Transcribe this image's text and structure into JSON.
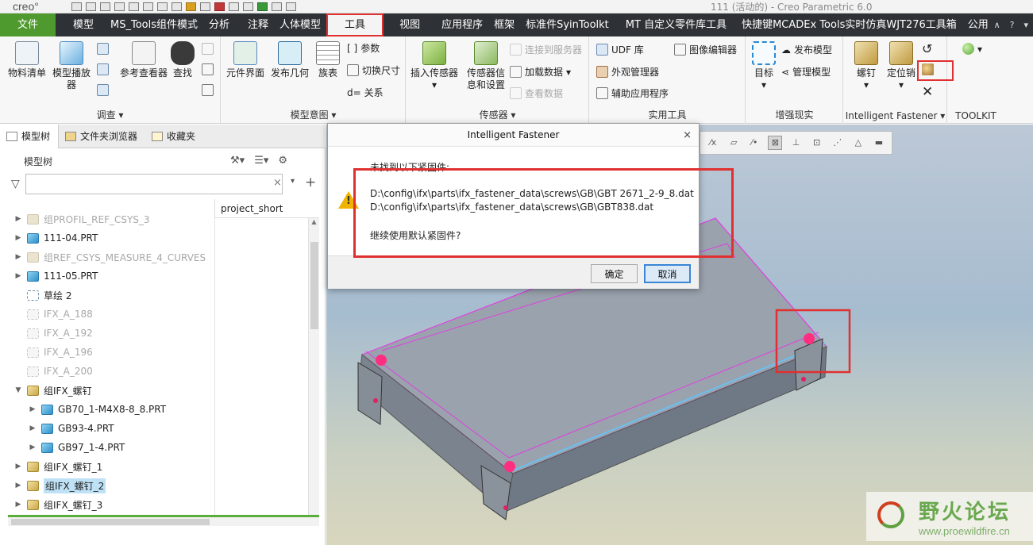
{
  "app": {
    "logo": "creo°",
    "window_title": "111 (活动的) - Creo Parametric 6.0"
  },
  "menu": {
    "tabs": [
      "文件",
      "模型",
      "MS_Tools组件模式",
      "分析",
      "注释",
      "人体模型",
      "工具",
      "视图",
      "应用程序",
      "框架",
      "标准件SyinToolkt",
      "MT 自定义零件库工具",
      "快捷键MCADEx Tools实时仿真WJT276工具箱",
      "公用"
    ],
    "active_tab": "工具"
  },
  "ribbon": {
    "groups": {
      "investigate": {
        "label": "调查",
        "buttons": [
          "物料清单",
          "模型播放器",
          "参考查看器",
          "查找"
        ]
      },
      "model_intent": {
        "label": "模型意图",
        "buttons": [
          "元件界面",
          "发布几何",
          "族表"
        ],
        "small": [
          "参数",
          "切换尺寸",
          "关系"
        ]
      },
      "sensor": {
        "label": "传感器",
        "buttons": [
          "插入传感器",
          "传感器信息和设置"
        ],
        "small": [
          "连接到服务器",
          "加载数据",
          "查看数据"
        ]
      },
      "utilities": {
        "label": "实用工具",
        "small": [
          "UDF 库",
          "外观管理器",
          "辅助应用程序",
          "图像编辑器"
        ]
      },
      "ar": {
        "label": "增强现实",
        "buttons": [
          "目标"
        ],
        "small": [
          "发布模型",
          "管理模型"
        ]
      },
      "fastener": {
        "label": "Intelligent Fastener",
        "buttons": [
          "螺钉",
          "定位销"
        ]
      },
      "toolkit": {
        "label": "TOOLKIT"
      }
    }
  },
  "panel": {
    "tabs": [
      "模型树",
      "文件夹浏览器",
      "收藏夹"
    ],
    "title": "模型树",
    "filter_placeholder": "",
    "column": "project_short",
    "tree": [
      {
        "label": "组PROFIL_REF_CSYS_3",
        "state": "grey",
        "icon": "asm-dim",
        "expand": true,
        "indent": 0
      },
      {
        "label": "111-04.PRT",
        "state": "normal",
        "icon": "part",
        "expand": true,
        "indent": 0
      },
      {
        "label": "组REF_CSYS_MEASURE_4_CURVES",
        "state": "grey",
        "icon": "asm-dim",
        "expand": true,
        "indent": 0
      },
      {
        "label": "111-05.PRT",
        "state": "normal",
        "icon": "part",
        "expand": true,
        "indent": 0
      },
      {
        "label": "草绘 2",
        "state": "normal",
        "icon": "sketch",
        "expand": false,
        "indent": 0
      },
      {
        "label": "IFX_A_188",
        "state": "grey",
        "icon": "dim",
        "expand": false,
        "indent": 0
      },
      {
        "label": "IFX_A_192",
        "state": "grey",
        "icon": "dim",
        "expand": false,
        "indent": 0
      },
      {
        "label": "IFX_A_196",
        "state": "grey",
        "icon": "dim",
        "expand": false,
        "indent": 0
      },
      {
        "label": "IFX_A_200",
        "state": "grey",
        "icon": "dim",
        "expand": false,
        "indent": 0
      },
      {
        "label": "组IFX_螺钉",
        "state": "normal",
        "icon": "asm",
        "expand": true,
        "open": true,
        "indent": 0
      },
      {
        "label": "GB70_1-M4X8-8_8.PRT",
        "state": "normal",
        "icon": "part",
        "expand": true,
        "indent": 1
      },
      {
        "label": "GB93-4.PRT",
        "state": "normal",
        "icon": "part",
        "expand": true,
        "indent": 1
      },
      {
        "label": "GB97_1-4.PRT",
        "state": "normal",
        "icon": "part",
        "expand": true,
        "indent": 1
      },
      {
        "label": "组IFX_螺钉_1",
        "state": "normal",
        "icon": "asm",
        "expand": true,
        "indent": 0
      },
      {
        "label": "组IFX_螺钉_2",
        "state": "selected",
        "icon": "asm",
        "expand": true,
        "indent": 0
      },
      {
        "label": "组IFX_螺钉_3",
        "state": "normal",
        "icon": "asm",
        "expand": true,
        "indent": 0
      }
    ]
  },
  "dialog": {
    "title": "Intelligent Fastener",
    "message_head": "未找到以下紧固件:",
    "missing_files": [
      "D:\\config\\ifx\\parts\\ifx_fastener_data\\screws\\GB\\GBT 2671_2-9_8.dat",
      "D:\\config\\ifx\\parts\\ifx_fastener_data\\screws\\GB\\GBT838.dat"
    ],
    "question": "继续使用默认紧固件?",
    "ok_label": "确定",
    "cancel_label": "取消"
  },
  "watermark": {
    "text": "野火论坛",
    "url": "www.proewildfire.cn"
  },
  "colors": {
    "menu_bg": "#2e3236",
    "file_tab": "#4e9a2e",
    "highlight": "#e03030",
    "edge_magenta": "#e040e0"
  }
}
